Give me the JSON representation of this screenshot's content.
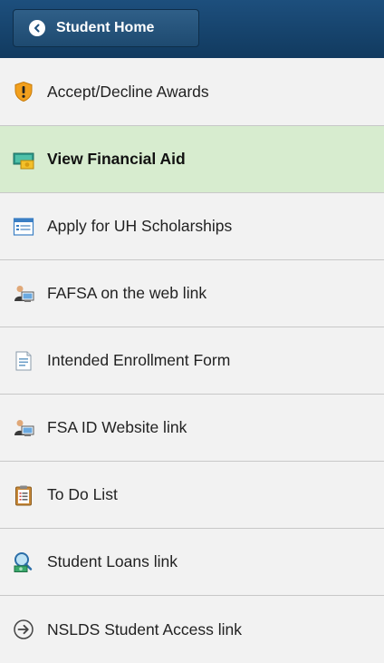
{
  "header": {
    "back_label": "Student Home",
    "background": "#1d4f7d"
  },
  "nav": {
    "items": [
      {
        "label": "Accept/Decline Awards",
        "icon": "shield-alert-icon",
        "active": false
      },
      {
        "label": "View Financial Aid",
        "icon": "money-icon",
        "active": true
      },
      {
        "label": "Apply for UH Scholarships",
        "icon": "window-list-icon",
        "active": false
      },
      {
        "label": "FAFSA on the web link",
        "icon": "person-computer-icon",
        "active": false
      },
      {
        "label": "Intended Enrollment Form",
        "icon": "form-document-icon",
        "active": false
      },
      {
        "label": "FSA ID Website link",
        "icon": "person-computer-icon",
        "active": false
      },
      {
        "label": "To Do List",
        "icon": "clipboard-icon",
        "active": false
      },
      {
        "label": "Student Loans link",
        "icon": "magnifier-money-icon",
        "active": false
      },
      {
        "label": "NSLDS Student Access link",
        "icon": "arrow-circle-icon",
        "active": false
      }
    ],
    "active_color": "#d7eccf"
  }
}
